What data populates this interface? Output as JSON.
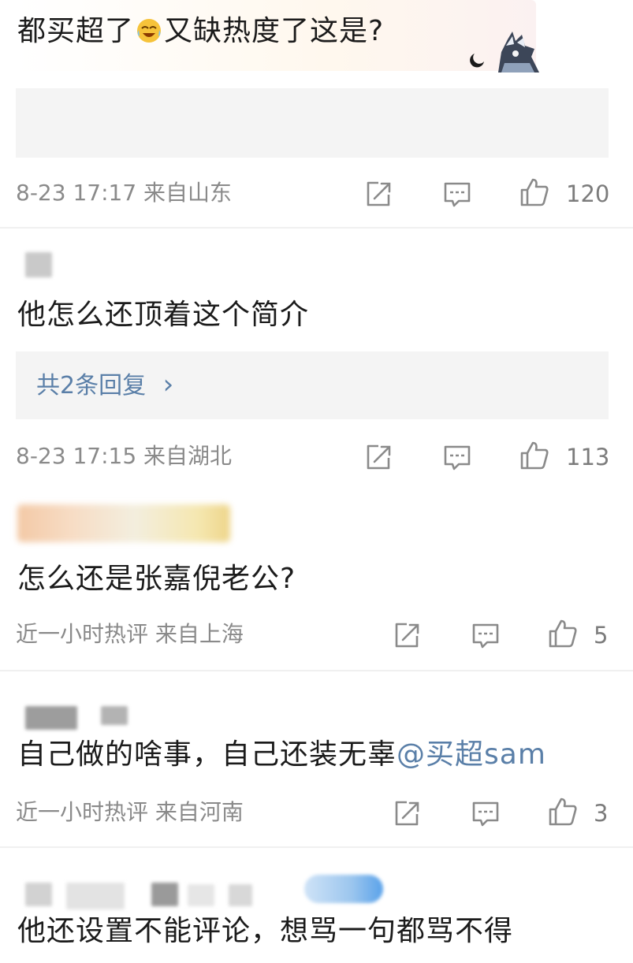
{
  "comments": [
    {
      "text_before_emoji": "都买超了",
      "emoji": "cry-laugh-emoji",
      "text_after_emoji": "又缺热度了这是?",
      "meta": "8-23 17:17  来自山东",
      "likes": "120"
    },
    {
      "text": "他怎么还顶着这个简介",
      "replies_label": "共2条回复",
      "replies_chevron": "›",
      "meta": "8-23 17:15  来自湖北",
      "likes": "113"
    },
    {
      "text": "怎么还是张嘉倪老公?",
      "meta": "近一小时热评  来自上海",
      "likes": "5"
    },
    {
      "text": "自己做的啥事，自己还装无辜",
      "mention": "@买超sam",
      "meta": "近一小时热评  来自河南",
      "likes": "3"
    },
    {
      "text": "他还设置不能评论，想骂一句都骂不得"
    }
  ],
  "icons": {
    "share": "share-icon",
    "comment": "comment-icon",
    "like": "thumbs-up-icon"
  },
  "colors": {
    "text": "#1b1b1b",
    "meta": "#8a8a8a",
    "link": "#5a7fa8",
    "reply_bg": "#f4f4f4"
  }
}
